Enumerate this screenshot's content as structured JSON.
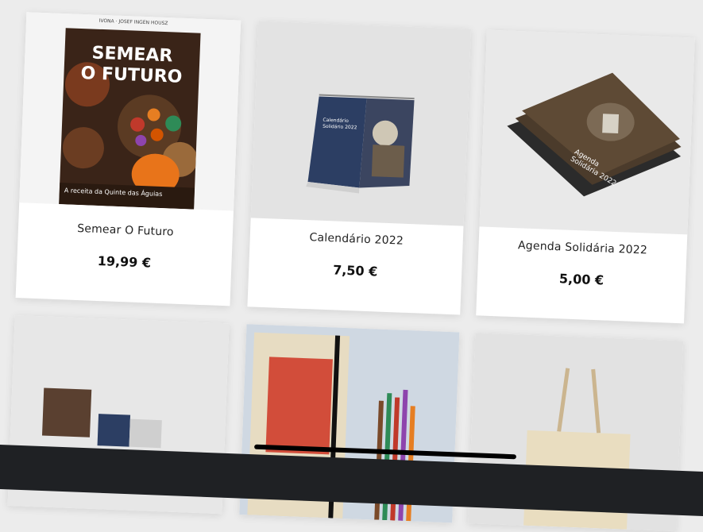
{
  "products": [
    {
      "name": "Semear O Futuro",
      "price": "19,99 €",
      "image_icon": "book-cover-icon",
      "cover": {
        "author": "IVONA · JOSEF INGEN HOUSZ",
        "title_line1": "SEMEAR",
        "title_line2": "O FUTURO",
        "subtitle": "A receita da Quinte das Águias"
      }
    },
    {
      "name": "Calendário 2022",
      "price": "7,50 €",
      "image_icon": "desk-calendar-icon",
      "cover": {
        "title": "Calendário Solidário 2022"
      }
    },
    {
      "name": "Agenda Solidária 2022",
      "price": "5,00 €",
      "image_icon": "agenda-stack-icon",
      "cover": {
        "title": "Agenda Solidária 2022"
      }
    },
    {
      "name": "",
      "price": "",
      "image_icon": "postcards-icon"
    },
    {
      "name": "",
      "price": "",
      "image_icon": "notebook-pencils-icon"
    },
    {
      "name": "",
      "price": "",
      "image_icon": "tote-bag-icon"
    }
  ],
  "colors": {
    "page_bg": "#ececec",
    "card_bg": "#ffffff",
    "bottom_bar": "#1f2124"
  }
}
